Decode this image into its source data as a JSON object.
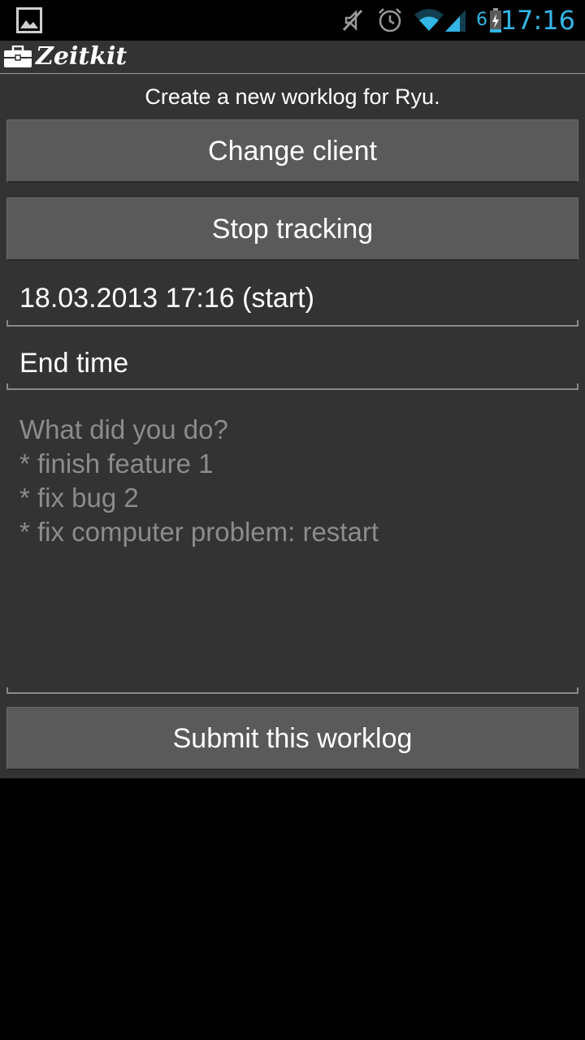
{
  "status_bar": {
    "time": "17:16",
    "battery_level": "6",
    "icons": [
      "gallery-notification-icon",
      "mute-icon",
      "alarm-icon",
      "wifi-icon",
      "signal-icon",
      "battery-charging-icon"
    ]
  },
  "app": {
    "title": "Zeitkit",
    "logo_icon": "briefcase-icon"
  },
  "form": {
    "subtitle": "Create a new worklog for Ryu.",
    "change_client_label": "Change client",
    "stop_tracking_label": "Stop tracking",
    "start_time_value": "18.03.2013 17:16 (start)",
    "end_time_value": "End time",
    "notes_placeholder": "What did you do?\n* finish feature 1\n* fix bug 2\n* fix computer problem: restart",
    "submit_label": "Submit this worklog"
  },
  "colors": {
    "accent": "#33b5e5",
    "background": "#333333",
    "button": "#5a5a5a"
  }
}
